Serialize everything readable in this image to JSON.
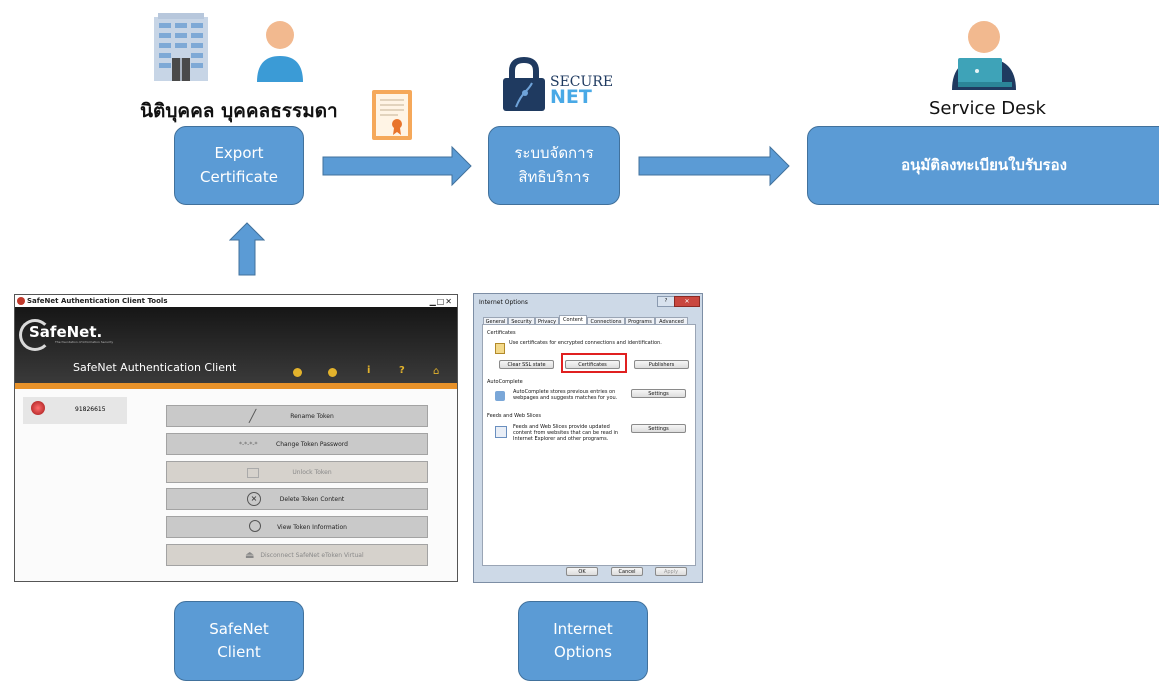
{
  "header": {
    "entity_label": "นิติบุคคล บุคคลธรรมดา",
    "service_desk_label": "Service Desk",
    "logo_secure": "SECURE",
    "logo_net": "NET"
  },
  "nodes": {
    "export_line1": "Export",
    "export_line2": "Certificate",
    "system_line1": "ระบบจัดการ",
    "system_line2": "สิทธิบริการ",
    "approve": "อนุมัติลงทะเบียนใบรับรอง",
    "safenet_line1": "SafeNet",
    "safenet_line2": "Client",
    "ieopt_line1": "Internet",
    "ieopt_line2": "Options"
  },
  "safenet": {
    "window_title": "SafeNet Authentication Client Tools",
    "brand": "SafeNet.",
    "tagline": "The foundation of Information Security",
    "app_name": "SafeNet Authentication Client",
    "token_id": "91826615",
    "actions": [
      "Rename Token",
      "Change Token Password",
      "Unlock Token",
      "Delete Token Content",
      "View Token Information",
      "Disconnect SafeNet eToken Virtual"
    ],
    "password_dots": "*-*-*-*"
  },
  "ie_options": {
    "title": "Internet Options",
    "tabs": [
      "General",
      "Security",
      "Privacy",
      "Content",
      "Connections",
      "Programs",
      "Advanced"
    ],
    "certificates_heading": "Certificates",
    "certificates_desc": "Use certificates for encrypted connections and identification.",
    "btn_clear_ssl": "Clear SSL state",
    "btn_certificates": "Certificates",
    "btn_publishers": "Publishers",
    "autocomplete_heading": "AutoComplete",
    "autocomplete_desc": "AutoComplete stores previous entries on webpages and suggests matches for you.",
    "btn_settings": "Settings",
    "feeds_heading": "Feeds and Web Slices",
    "feeds_desc": "Feeds and Web Slices provide updated content from websites that can be read in Internet Explorer and other programs.",
    "btn_ok": "OK",
    "btn_cancel": "Cancel",
    "btn_apply": "Apply"
  },
  "colors": {
    "node_fill": "#5b9bd5",
    "node_border": "#41719c",
    "highlight": "#e02020"
  }
}
